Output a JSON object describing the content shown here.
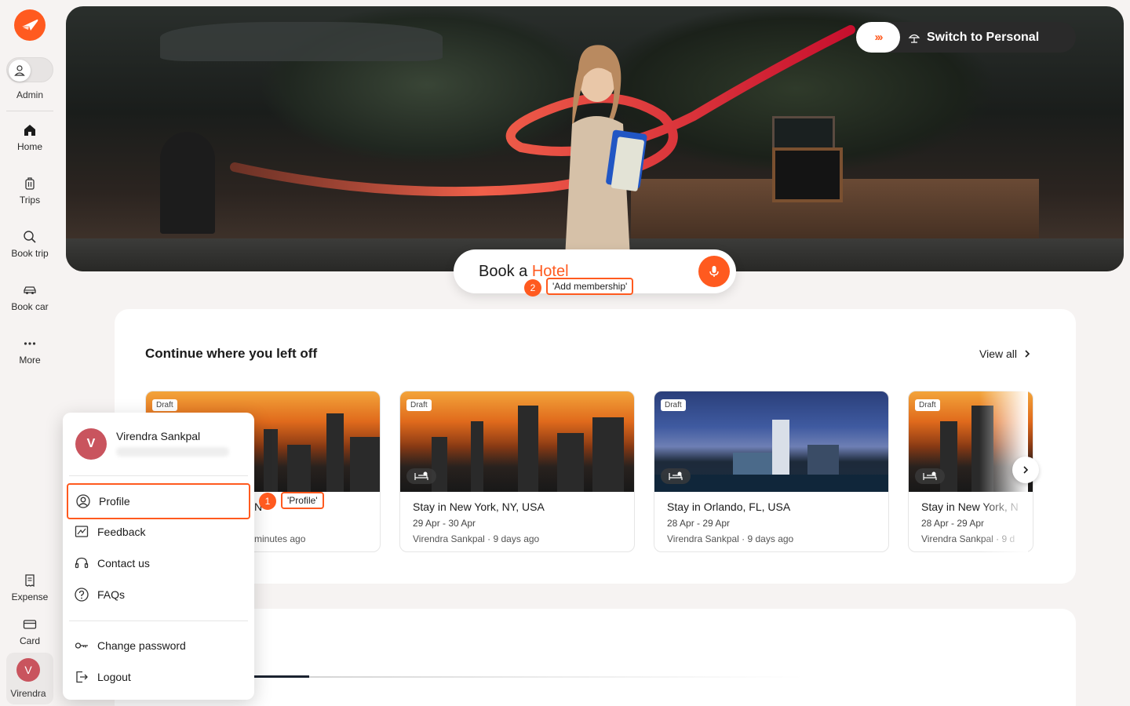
{
  "sidebar": {
    "admin_label": "Admin",
    "items": [
      {
        "label": "Home"
      },
      {
        "label": "Trips"
      },
      {
        "label": "Book trip"
      },
      {
        "label": "Book car"
      },
      {
        "label": "More"
      }
    ],
    "bottom_items": [
      {
        "label": "Expense"
      },
      {
        "label": "Card"
      }
    ],
    "user": {
      "initial": "V",
      "label": "Virendra"
    }
  },
  "hero": {
    "switch_arrows": "›››",
    "switch_label": "Switch to Personal"
  },
  "search": {
    "prefix": "Book a ",
    "accent": "Hotel"
  },
  "annotations": [
    {
      "num": "1",
      "text": "'Profile'"
    },
    {
      "num": "2",
      "text": "'Add membership'"
    }
  ],
  "continue_section": {
    "title": "Continue where you left off",
    "view_all": "View all",
    "cards": [
      {
        "badge": "Draft",
        "badge_count": "1",
        "title": "Stay in New York, NY, USA",
        "dates": "",
        "meta": "minutes ago",
        "title_visible": "N"
      },
      {
        "badge": "Draft",
        "badge_count": "1",
        "title": "Stay in New York, NY, USA",
        "dates": "29 Apr - 30 Apr",
        "meta": "Virendra Sankpal · 9 days ago"
      },
      {
        "badge": "Draft",
        "badge_count": "1",
        "title": "Stay in Orlando, FL, USA",
        "dates": "28 Apr - 29 Apr",
        "meta": "Virendra Sankpal · 9 days ago"
      },
      {
        "badge": "Draft",
        "badge_count": "1",
        "title": "Stay in New York, N",
        "dates": "28 Apr - 29 Apr",
        "meta": "Virendra Sankpal · 9 d"
      }
    ]
  },
  "user_menu": {
    "initial": "V",
    "name": "Virendra Sankpal",
    "items": [
      {
        "label": "Profile"
      },
      {
        "label": "Feedback"
      },
      {
        "label": "Contact us"
      },
      {
        "label": "FAQs"
      },
      {
        "label": "Change password"
      },
      {
        "label": "Logout"
      }
    ]
  },
  "colors": {
    "brand": "#ff5a1f",
    "avatar": "#c9545e",
    "background": "#f6f3f2"
  }
}
